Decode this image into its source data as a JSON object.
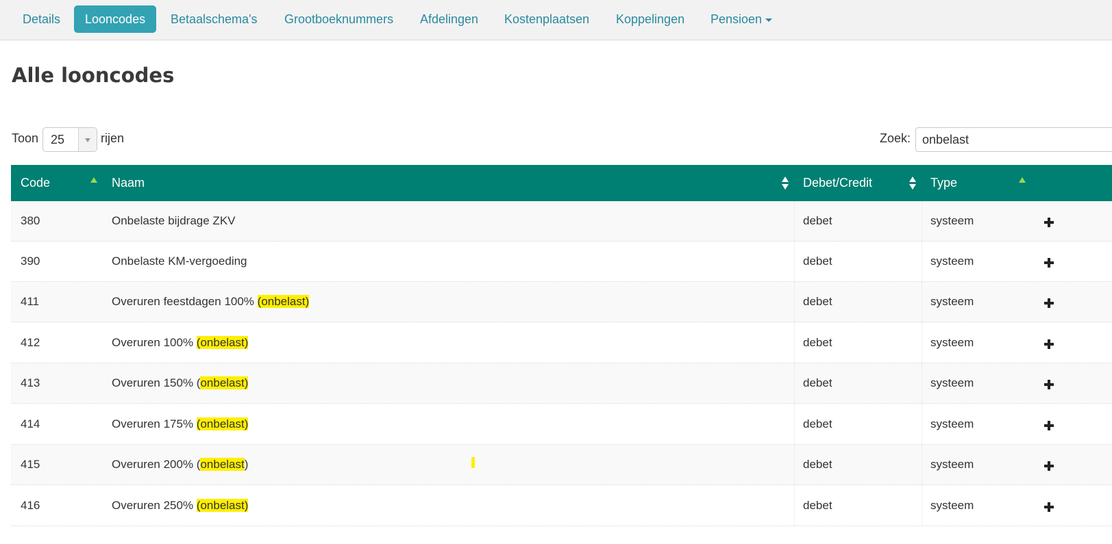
{
  "nav": {
    "tabs": [
      {
        "label": "Details"
      },
      {
        "label": "Looncodes"
      },
      {
        "label": "Betaalschema's"
      },
      {
        "label": "Grootboeknummers"
      },
      {
        "label": "Afdelingen"
      },
      {
        "label": "Kostenplaatsen"
      },
      {
        "label": "Koppelingen"
      },
      {
        "label": "Pensioen"
      }
    ],
    "active_tab": "Looncodes"
  },
  "page": {
    "title": "Alle looncodes"
  },
  "length": {
    "prefix": "Toon",
    "value": "25",
    "suffix": "rijen"
  },
  "search": {
    "label": "Zoek:",
    "value": "onbelast"
  },
  "table": {
    "columns": [
      "Code",
      "Naam",
      "Debet/Credit",
      "Type"
    ],
    "rows": [
      {
        "code": "380",
        "name": "Onbelaste bijdrage ZKV",
        "dc": "debet",
        "type": "systeem"
      },
      {
        "code": "390",
        "name": "Onbelaste KM-vergoeding",
        "dc": "debet",
        "type": "systeem"
      },
      {
        "code": "411",
        "name_prefix": "Overuren feestdagen 100% ",
        "name_highlight": "(onbelast)",
        "dc": "debet",
        "type": "systeem"
      },
      {
        "code": "412",
        "name_prefix": "Overuren 100% ",
        "name_highlight": "(onbelast)",
        "dc": "debet",
        "type": "systeem"
      },
      {
        "code": "413",
        "name_prefix": "Overuren 150% (",
        "name_highlight": "onbelast)",
        "dc": "debet",
        "type": "systeem"
      },
      {
        "code": "414",
        "name_prefix": "Overuren 175% ",
        "name_highlight": "(onbelast)",
        "dc": "debet",
        "type": "systeem"
      },
      {
        "code": "415",
        "name_prefix": "Overuren 200% (",
        "name_highlight": "onbelast",
        "name_suffix": ")",
        "dc": "debet",
        "type": "systeem"
      },
      {
        "code": "416",
        "name_prefix": "Overuren 250% ",
        "name_highlight": "(onbelast)",
        "dc": "debet",
        "type": "systeem"
      }
    ]
  },
  "colors": {
    "header_bg": "#008073",
    "active_tab_bg": "#33a2b3",
    "link": "#2a8aa0",
    "highlight": "#ffef00",
    "sort_arrow": "#9bd84f"
  }
}
